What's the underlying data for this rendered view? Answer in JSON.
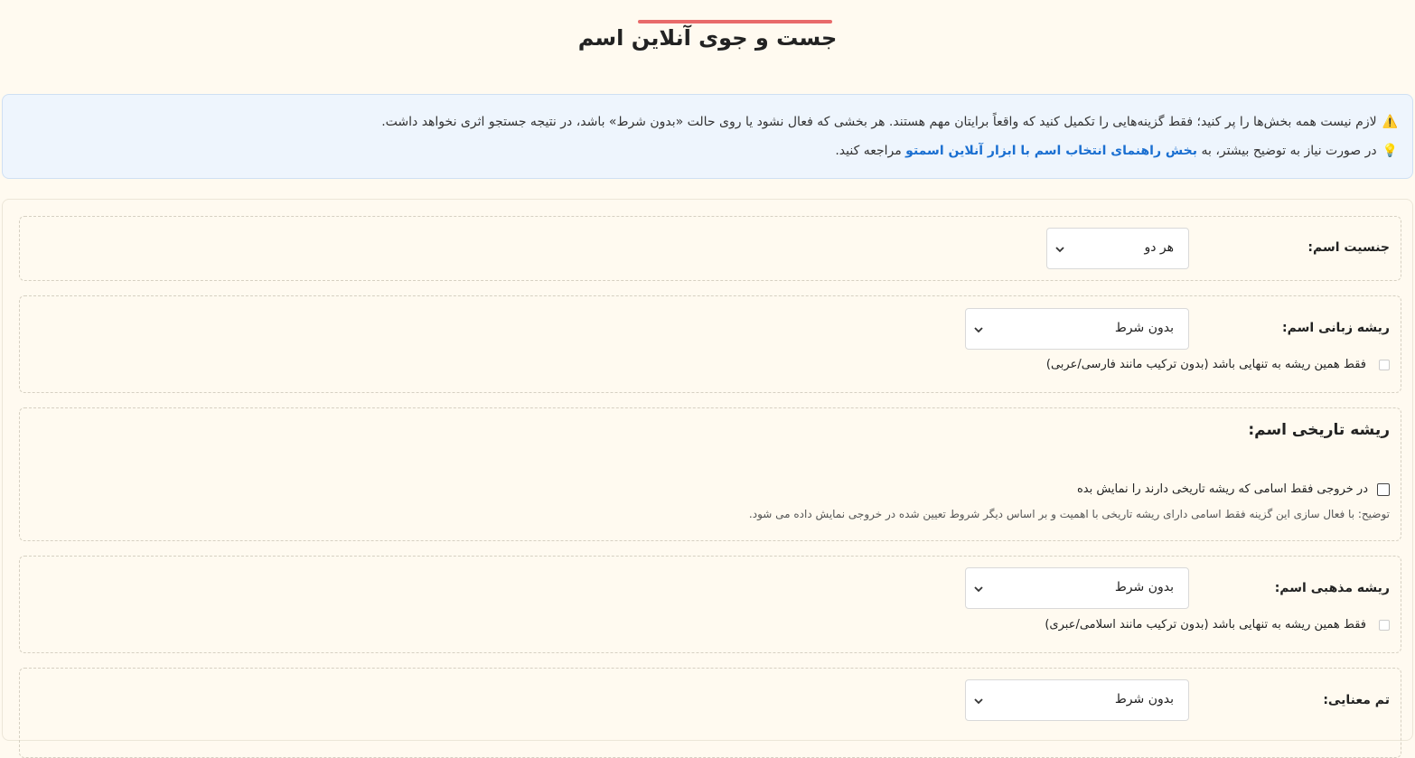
{
  "page": {
    "title": "جست و جوی آنلاین اسم"
  },
  "notice": {
    "warning_icon": "⚠️",
    "warning_text": "لازم نیست همه بخش‌ها را پر کنید؛ فقط گزینه‌هایی را تکمیل کنید که واقعاً برایتان مهم هستند. هر بخشی که فعال نشود یا روی حالت «بدون شرط» باشد، در نتیجه جستجو اثری نخواهد داشت.",
    "tip_icon": "💡",
    "tip_prefix": "در صورت نیاز به توضیح بیشتر، به ",
    "tip_link": "بخش راهنمای انتخاب اسم با ابزار آنلاین اسمتو",
    "tip_suffix": " مراجعه کنید."
  },
  "form": {
    "gender": {
      "label": "جنسیت اسم:",
      "value": "هر دو"
    },
    "language_root": {
      "label": "ریشه زبانی اسم:",
      "value": "بدون شرط",
      "only_checkbox": "فقط همین ریشه به تنهایی باشد (بدون ترکیب مانند فارسی/عربی)"
    },
    "historical_root": {
      "label": "ریشه تاریخی اسم:",
      "checkbox": "در خروجی فقط اسامی که ریشه تاریخی دارند را نمایش بده",
      "note": "توضیح: با فعال سازی این گزینه فقط اسامی دارای ریشه تاریخی با اهمیت و بر اساس دیگر شروط تعیین شده در خروجی نمایش داده می شود."
    },
    "religious_root": {
      "label": "ریشه مذهبی اسم:",
      "value": "بدون شرط",
      "only_checkbox": "فقط همین ریشه به تنهایی باشد (بدون ترکیب مانند اسلامی/عبری)"
    },
    "meaning_theme": {
      "label": "تم معنایی:",
      "value": "بدون شرط"
    }
  },
  "colors": {
    "accent": "#e86a6a",
    "link": "#1a6fd1",
    "background": "#fffaf0",
    "notice_bg": "#eef5fd"
  }
}
